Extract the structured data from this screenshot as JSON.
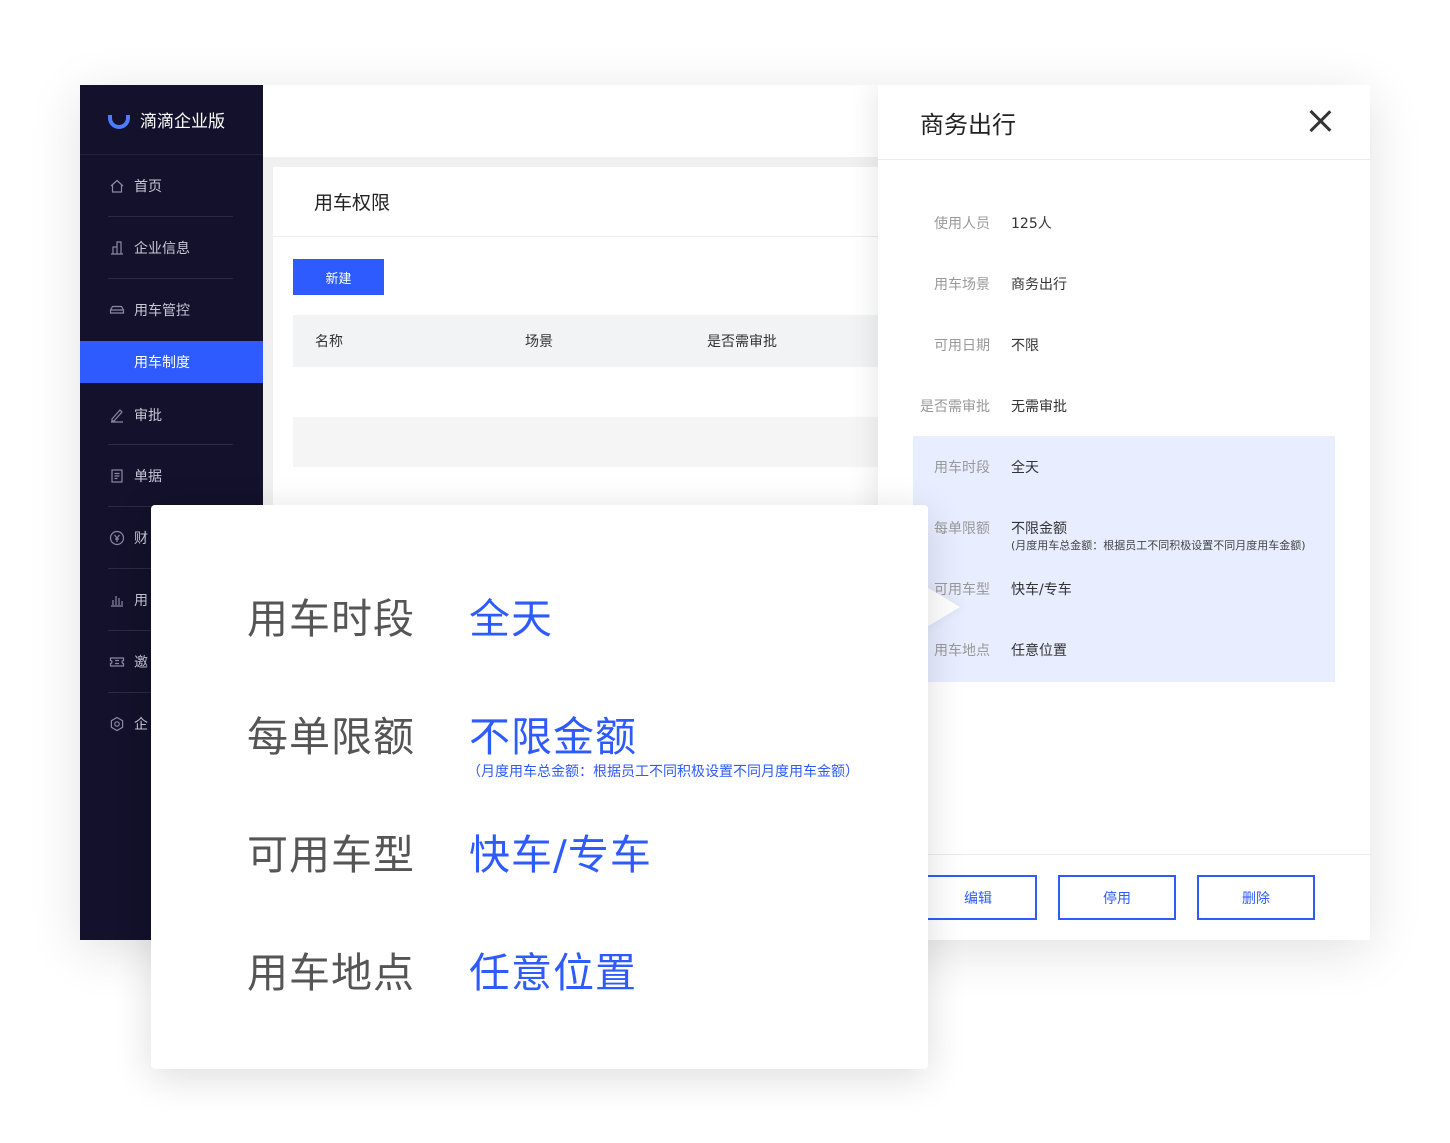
{
  "app": {
    "logo_text": "滴滴企业版"
  },
  "sidebar": {
    "items": [
      {
        "label": "首页",
        "icon": "home-icon"
      },
      {
        "label": "企业信息",
        "icon": "building-icon"
      },
      {
        "label": "用车管控",
        "icon": "car-icon"
      },
      {
        "label": "审批",
        "icon": "pen-icon"
      },
      {
        "label": "单据",
        "icon": "document-icon"
      },
      {
        "label": "财",
        "icon": "yen-icon"
      },
      {
        "label": "用",
        "icon": "bar-chart-icon"
      },
      {
        "label": "邀",
        "icon": "ticket-icon"
      },
      {
        "label": "企",
        "icon": "gear-icon"
      }
    ],
    "active_sub": "用车制度"
  },
  "main": {
    "card_title": "用车权限",
    "new_button": "新建",
    "columns": [
      "名称",
      "场景",
      "是否需审批"
    ]
  },
  "drawer": {
    "title": "商务出行",
    "rows": [
      {
        "label": "使用人员",
        "value": "125人"
      },
      {
        "label": "用车场景",
        "value": "商务出行"
      },
      {
        "label": "可用日期",
        "value": "不限"
      },
      {
        "label": "是否需审批",
        "value": "无需审批"
      },
      {
        "label": "用车时段",
        "value": "全天"
      },
      {
        "label": "每单限额",
        "value": "不限金额",
        "note": "(月度用车总金额：根据员工不同积极设置不同月度用车金额)"
      },
      {
        "label": "可用车型",
        "value": "快车/专车"
      },
      {
        "label": "用车地点",
        "value": "任意位置"
      }
    ],
    "buttons": [
      "编辑",
      "停用",
      "删除"
    ]
  },
  "zoom": {
    "rows": [
      {
        "label": "用车时段",
        "value": "全天"
      },
      {
        "label": "每单限额",
        "value": "不限金额",
        "note": "（月度用车总金额：根据员工不同积极设置不同月度用车金额）"
      },
      {
        "label": "可用车型",
        "value": "快车/专车"
      },
      {
        "label": "用车地点",
        "value": "任意位置"
      }
    ]
  },
  "colors": {
    "brand": "#2e5bfe",
    "sidebar_bg": "#13112b",
    "highlight_bg": "#e8edff"
  }
}
